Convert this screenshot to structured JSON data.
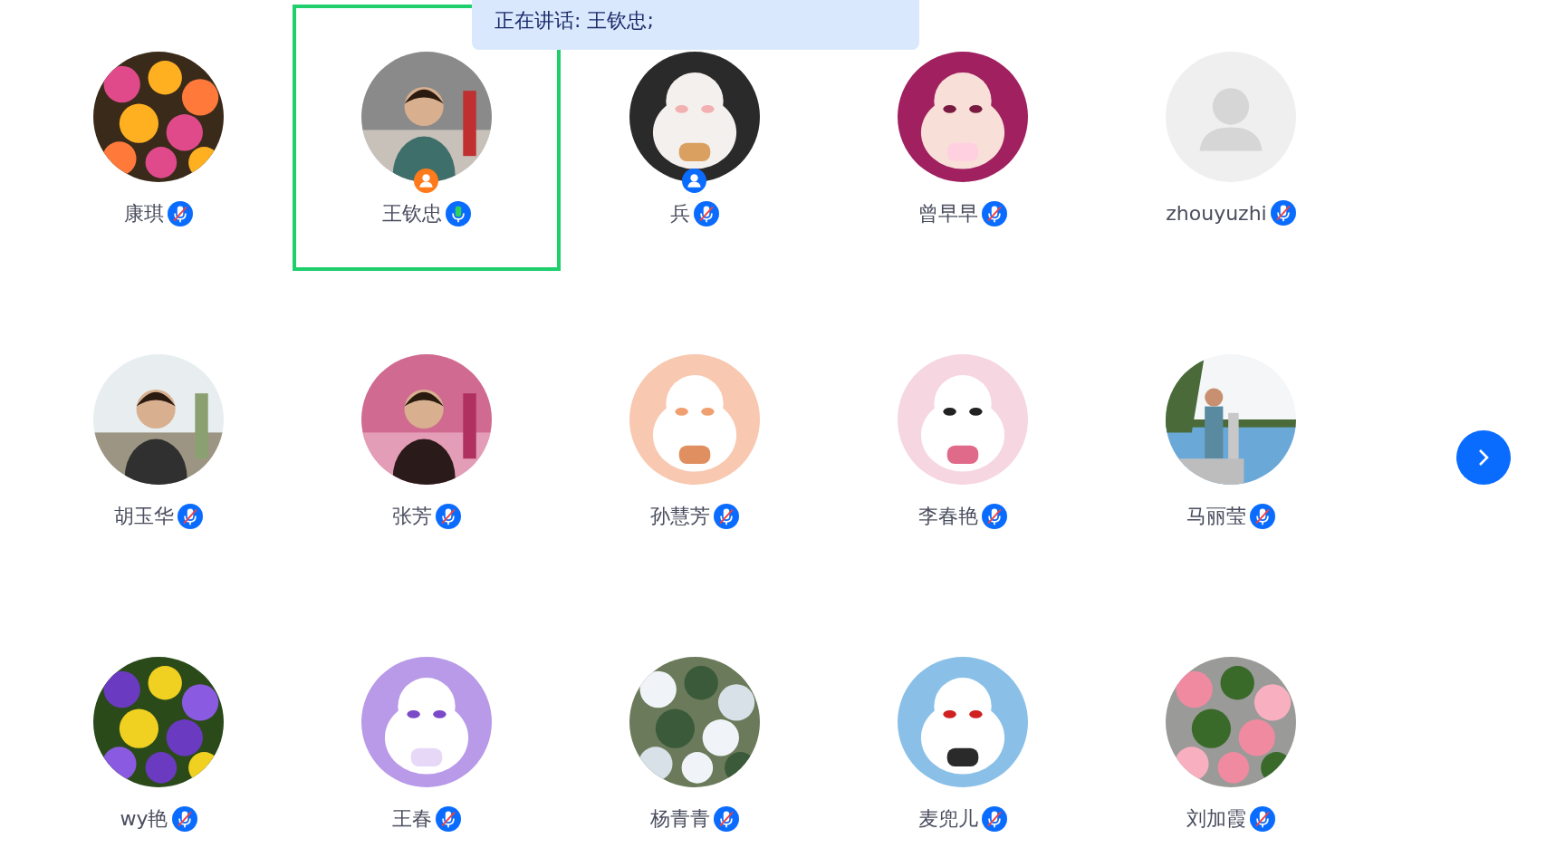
{
  "speaking_banner": "正在讲话: 王钦忠;",
  "participants": [
    {
      "name": "康琪",
      "muted": true,
      "selected": false
    },
    {
      "name": "王钦忠",
      "badge": {
        "color": "#ff7a1a"
      },
      "muted": false,
      "selected": true
    },
    {
      "name": "兵",
      "badge": {
        "color": "#0a6cff"
      },
      "muted": true,
      "selected": false
    },
    {
      "name": "曾早早",
      "muted": true,
      "selected": false
    },
    {
      "name": "zhouyuzhi",
      "avatar": {
        "kind": "placeholder"
      },
      "muted": true,
      "selected": false
    },
    {
      "name": "胡玉华",
      "muted": true,
      "selected": false
    },
    {
      "name": "张芳",
      "muted": true,
      "selected": false
    },
    {
      "name": "孙慧芳",
      "muted": true,
      "selected": false
    },
    {
      "name": "李春艳",
      "muted": true,
      "selected": false
    },
    {
      "name": "马丽莹",
      "muted": true,
      "selected": false
    },
    {
      "name": "wy艳",
      "muted": true,
      "selected": false
    },
    {
      "name": "王春",
      "muted": true,
      "selected": false
    },
    {
      "name": "杨青青",
      "muted": true,
      "selected": false
    },
    {
      "name": "麦兜儿",
      "muted": true,
      "selected": false
    },
    {
      "name": "刘加霞",
      "muted": true,
      "selected": false
    }
  ]
}
